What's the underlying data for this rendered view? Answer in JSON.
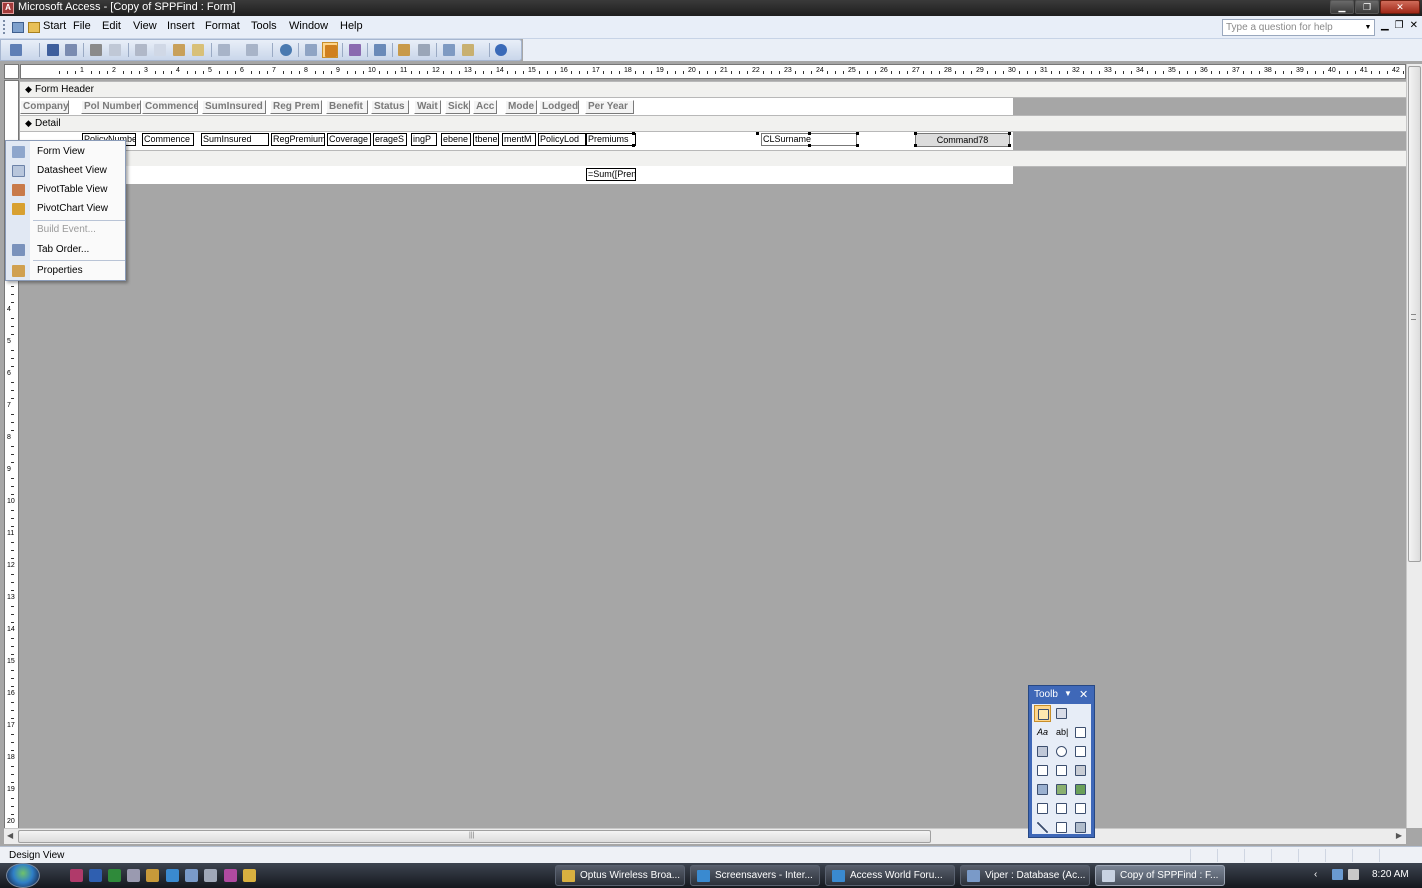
{
  "window": {
    "title": "Microsoft Access - [Copy of SPPFind : Form]"
  },
  "menubar": {
    "items": [
      "Start",
      "File",
      "Edit",
      "View",
      "Insert",
      "Format",
      "Tools",
      "Window",
      "Help"
    ],
    "help_placeholder": "Type a question for help"
  },
  "sections": {
    "form_header": "Form Header",
    "detail": "Detail"
  },
  "header_labels": [
    "Company",
    "Pol Number",
    "Commence",
    "SumInsured",
    "Reg Prem",
    "Benefit",
    "Status",
    "Wait",
    "Sick",
    "Acc",
    "Mode",
    "Lodged",
    "Per Year"
  ],
  "detail_fields": [
    "PolicyNumbe",
    "Commence",
    "SumInsured",
    "RegPremium",
    "Coverage",
    "erageS",
    "ingP",
    "ebene",
    "tbene",
    "mentM",
    "PolicyLod",
    "Premiums",
    "CLSurname"
  ],
  "detail_button": "Command78",
  "footer_field": "=Sum([Pren",
  "context_menu": {
    "items": [
      {
        "label": "Form View",
        "icon": "form-view-icon",
        "enabled": true
      },
      {
        "label": "Datasheet View",
        "icon": "datasheet-view-icon",
        "enabled": true
      },
      {
        "label": "PivotTable View",
        "icon": "pivottable-view-icon",
        "enabled": true
      },
      {
        "label": "PivotChart View",
        "icon": "pivotchart-view-icon",
        "enabled": true
      },
      {
        "label": "Build Event...",
        "icon": "",
        "enabled": false
      },
      {
        "label": "Tab Order...",
        "icon": "tab-order-icon",
        "enabled": true
      },
      {
        "label": "Properties",
        "icon": "properties-icon",
        "enabled": true
      }
    ]
  },
  "toolbox": {
    "title": "Toolb"
  },
  "statusbar": {
    "text": "Design View"
  },
  "taskbar": {
    "tasks": [
      {
        "label": "Optus Wireless Broa...",
        "active": false
      },
      {
        "label": "Screensavers - Inter...",
        "active": false
      },
      {
        "label": "Access World Foru...",
        "active": false
      },
      {
        "label": "Viper : Database (Ac...",
        "active": false
      },
      {
        "label": "Copy of SPPFind : F...",
        "active": true
      }
    ],
    "clock": "8:20 AM"
  },
  "ruler": {
    "horizontal": [
      "1",
      "2",
      "3",
      "4",
      "5",
      "6",
      "7",
      "8",
      "9",
      "10",
      "11",
      "12",
      "13",
      "14",
      "15",
      "16",
      "17",
      "18",
      "19",
      "20",
      "21",
      "22",
      "23",
      "24",
      "25",
      "26",
      "27",
      "28",
      "29",
      "30",
      "31",
      "32",
      "33",
      "34",
      "35",
      "36",
      "37",
      "38",
      "39",
      "40",
      "41",
      "42",
      "43"
    ],
    "vertical": [
      "4",
      "5",
      "6",
      "7",
      "8",
      "9",
      "10",
      "11",
      "12",
      "13",
      "14",
      "15",
      "16",
      "17",
      "18",
      "19",
      "20"
    ]
  },
  "colors": {
    "accent": "#3f68b8",
    "canvas": "#a6a6a6",
    "selected_tool": "#ffd68a"
  }
}
